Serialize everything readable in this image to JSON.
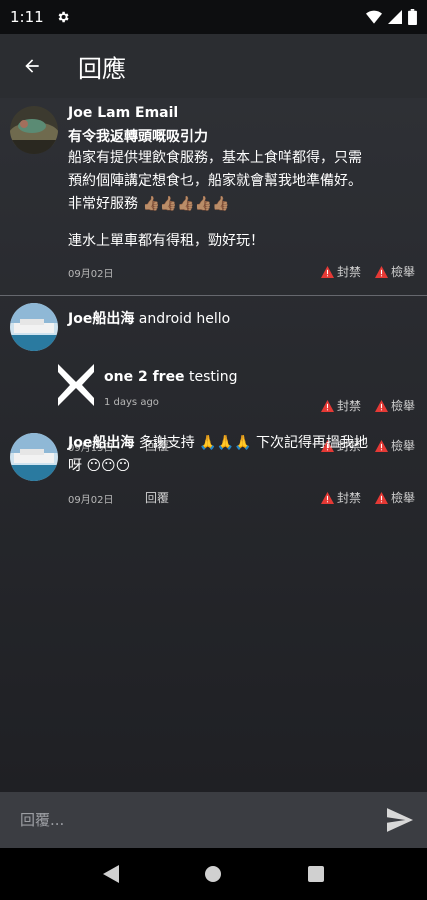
{
  "status": {
    "time": "1:11"
  },
  "header": {
    "title": "回應"
  },
  "comments": [
    {
      "author": "Joe Lam Email",
      "title": "有令我返轉頭嘅吸引力",
      "body_lines": [
        "船家有提供埋飲食服務，基本上食咩都得，只需",
        "預約個陣講定想食乜，船家就會幫我地準備好。",
        "非常好服務"
      ],
      "emojis": "👍🏽👍🏽👍🏽👍🏽👍🏽",
      "body_extra": "連水上單車都有得租，勁好玩！",
      "date": "09月02日",
      "ban": "封禁",
      "report": "檢舉"
    },
    {
      "author": "Joe船出海",
      "text": "android hello",
      "date": "09月15日",
      "reply": "回覆",
      "ban": "封禁",
      "report": "檢舉"
    },
    {
      "author": "one 2 free",
      "text": "testing",
      "date": "1 days ago",
      "ban": "封禁",
      "report": "檢舉"
    },
    {
      "author": "Joe船出海",
      "text": "多謝支持",
      "emojis1": "🙏🙏🙏",
      "text2": "下次記得再搵我地",
      "text3": "呀",
      "emojis2": "😶😶😶",
      "date": "09月02日",
      "reply": "回覆",
      "ban": "封禁",
      "report": "檢舉"
    }
  ],
  "composer": {
    "placeholder": "回覆..."
  },
  "colors": {
    "warning": "#e53935",
    "background": "#2b2d31"
  }
}
